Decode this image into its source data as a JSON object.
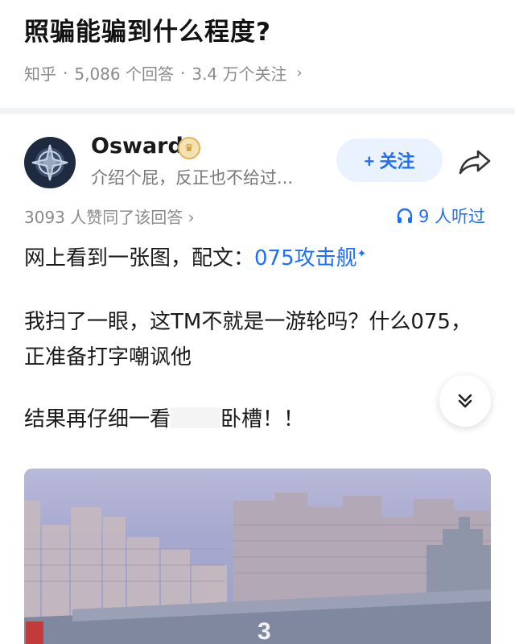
{
  "question": {
    "title": "照骗能骗到什么程度?",
    "source": "知乎",
    "answers": "5,086 个回答",
    "followers": "3.4 万个关注",
    "chevron": "›"
  },
  "author": {
    "name": "Osward",
    "bio": "介绍个屁，反正也不给过...",
    "follow_label": "+ 关注",
    "badge_icon": "crown-icon"
  },
  "answer": {
    "upvotes": "3093 人赞同了该回答 ›",
    "listen": "9 人听过",
    "p1_text": "网上看到一张图，配文：",
    "p1_link": "075攻击舰",
    "p1_sup": "✦",
    "p2": "我扫了一眼，这TM不就是一游轮吗？什么075，正准备打字嘲讽他",
    "p3_a": "结果再仔细一看",
    "p3_b": "卧槽！！"
  },
  "photo": {
    "ship_number": "3"
  },
  "colors": {
    "accent": "#1e6fff",
    "meta": "#8a8a8a",
    "follow_bg": "#eaf2ff"
  }
}
